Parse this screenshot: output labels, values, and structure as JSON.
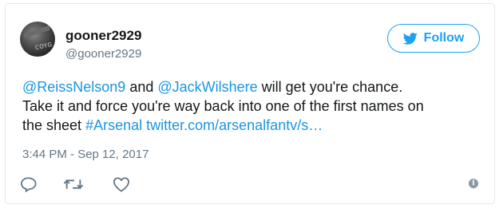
{
  "tweet": {
    "author": {
      "display_name": "gooner2929",
      "screen_name": "@gooner2929",
      "avatar_text": "COYG"
    },
    "follow_button": {
      "label": "Follow",
      "icon": "twitter-bird-icon"
    },
    "text": {
      "mention1": "@ReissNelson9",
      "and": " and ",
      "mention2": "@JackWilshere",
      "line1_rest": " will get you're chance.",
      "line2": "Take it and force you're way back into one of the first names on",
      "line3_start": "the sheet ",
      "hashtag": "#Arsenal",
      "space": " ",
      "link": "twitter.com/arsenalfantv/s…"
    },
    "timestamp": "3:44 PM - Sep 12, 2017",
    "actions": [
      "reply-icon",
      "retweet-icon",
      "like-icon"
    ],
    "info_icon": "i"
  },
  "colors": {
    "link": "#1b95e0",
    "follow": "#1da1f2",
    "text": "#14171a",
    "muted": "#657786",
    "border": "#e1e8ed"
  }
}
